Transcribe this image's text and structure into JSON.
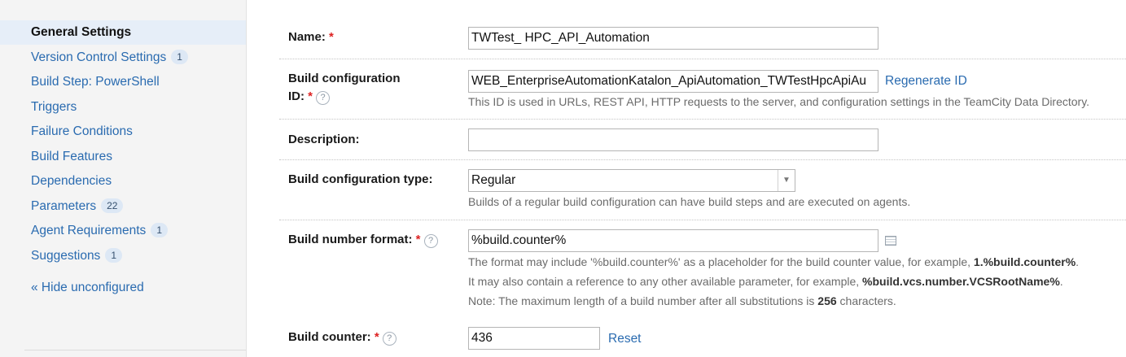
{
  "sidebar": {
    "items": [
      {
        "label": "General Settings",
        "count": ""
      },
      {
        "label": "Version Control Settings",
        "count": "1"
      },
      {
        "label": "Build Step: PowerShell",
        "count": ""
      },
      {
        "label": "Triggers",
        "count": ""
      },
      {
        "label": "Failure Conditions",
        "count": ""
      },
      {
        "label": "Build Features",
        "count": ""
      },
      {
        "label": "Dependencies",
        "count": ""
      },
      {
        "label": "Parameters",
        "count": "22"
      },
      {
        "label": "Agent Requirements",
        "count": "1"
      },
      {
        "label": "Suggestions",
        "count": "1"
      }
    ],
    "hide_unconfigured": "« Hide unconfigured"
  },
  "form": {
    "required_mark": "*",
    "help_glyph": "?",
    "name": {
      "label": "Name:",
      "value": "TWTest_ HPC_API_Automation"
    },
    "build_id": {
      "label_line1": "Build configuration",
      "label_line2": "ID:",
      "value": "WEB_EnterpriseAutomationKatalon_ApiAutomation_TWTestHpcApiAu",
      "regenerate": "Regenerate ID",
      "note": "This ID is used in URLs, REST API, HTTP requests to the server, and configuration settings in the TeamCity Data Directory."
    },
    "description": {
      "label": "Description:",
      "value": ""
    },
    "config_type": {
      "label": "Build configuration type:",
      "value": "Regular",
      "note": "Builds of a regular build configuration can have build steps and are executed on agents."
    },
    "number_format": {
      "label": "Build number format:",
      "value": "%build.counter%",
      "note1_pre": "The format may include '%build.counter%' as a placeholder for the build counter value, for example, ",
      "note1_bold": "1.%build.counter%",
      "note1_post": ".",
      "note2_pre": "It may also contain a reference to any other available parameter, for example, ",
      "note2_bold": "%build.vcs.number.VCSRootName%",
      "note2_post": ".",
      "note3_pre": "Note: The maximum length of a build number after all substitutions is ",
      "note3_bold": "256",
      "note3_post": " characters."
    },
    "counter": {
      "label": "Build counter:",
      "value": "436",
      "reset": "Reset"
    }
  }
}
